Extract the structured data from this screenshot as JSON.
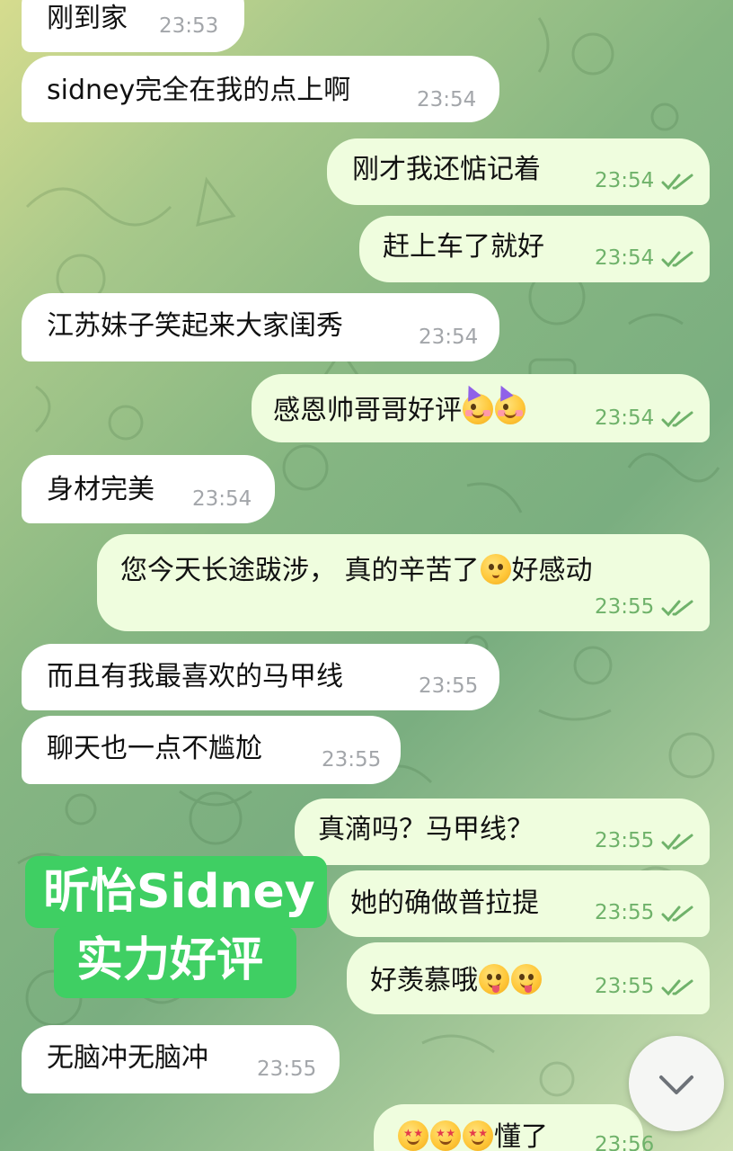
{
  "messages": [
    {
      "text": "刚到家",
      "time": "23:53"
    },
    {
      "text": "sidney完全在我的点上啊",
      "time": "23:54"
    },
    {
      "text": "刚才我还惦记着",
      "time": "23:54"
    },
    {
      "text": "赶上车了就好",
      "time": "23:54"
    },
    {
      "text": "江苏妹子笑起来大家闺秀",
      "time": "23:54"
    },
    {
      "text": "感恩帅哥哥好评",
      "time": "23:54"
    },
    {
      "text": "身材完美",
      "time": "23:54"
    },
    {
      "text": "您今天长途跋涉， 真的辛苦了",
      "text2": "好感动",
      "time": "23:55"
    },
    {
      "text": "而且有我最喜欢的马甲线",
      "time": "23:55"
    },
    {
      "text": "聊天也一点不尴尬",
      "time": "23:55"
    },
    {
      "text": "真滴吗？马甲线？",
      "time": "23:55"
    },
    {
      "text": "她的确做普拉提",
      "time": "23:55"
    },
    {
      "text": "好羡慕哦",
      "time": "23:55"
    },
    {
      "text": "无脑冲无脑冲",
      "time": "23:55"
    },
    {
      "text": "懂了",
      "time": "23:56"
    }
  ],
  "promo": {
    "line1": "昕怡Sidney",
    "line2": "实力好评",
    "color": "#3fcf63"
  },
  "colors": {
    "incoming_bubble": "#ffffff",
    "outgoing_bubble": "#effdde",
    "outgoing_time": "#6fb26a",
    "incoming_time": "#a3a6aa"
  },
  "icons": {
    "read_receipt": "double-check-icon",
    "scroll_down": "chevron-down-icon"
  }
}
